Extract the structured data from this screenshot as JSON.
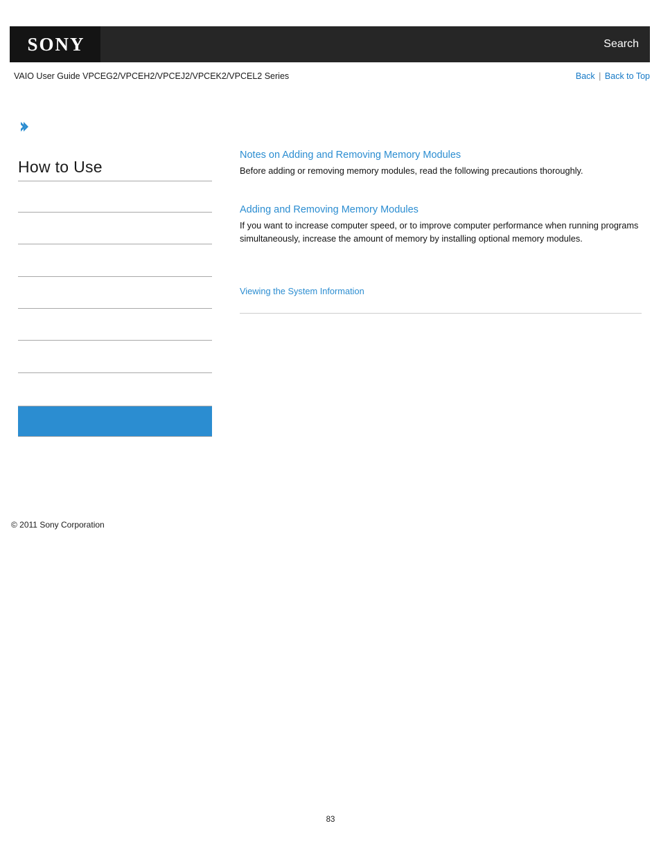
{
  "header": {
    "logo_text": "SONY",
    "search_label": "Search",
    "bar_color": "#262626",
    "logo_box_color": "#141414"
  },
  "subheader": {
    "title": "VAIO User Guide VPCEG2/VPCEH2/VPCEJ2/VPCEK2/VPCEL2 Series",
    "back_label": "Back",
    "separator": "|",
    "back_to_top_label": "Back to Top",
    "link_color": "#1579c6"
  },
  "sidebar": {
    "chevron_icon": "chevron-right-icon",
    "title": "How to Use",
    "accent_color": "#2b8dd1",
    "divider_color": "#a8a8a8",
    "items": [
      {
        "label": "",
        "active": false
      },
      {
        "label": "",
        "active": false
      },
      {
        "label": "",
        "active": false
      },
      {
        "label": "",
        "active": false
      },
      {
        "label": "",
        "active": false
      },
      {
        "label": "",
        "active": false
      },
      {
        "label": "",
        "active": false
      },
      {
        "label": "",
        "active": true
      },
      {
        "label": "",
        "active": false
      }
    ],
    "footer": "© 2011 Sony Corporation"
  },
  "content": {
    "sections": [
      {
        "heading": "Notes on Adding and Removing Memory Modules",
        "body": "Before adding or removing memory modules, read the following precautions thoroughly."
      },
      {
        "heading": "Adding and Removing Memory Modules",
        "body": "If you want to increase computer speed, or to improve computer performance when running programs simultaneously, increase the amount of memory by installing optional memory modules."
      }
    ],
    "related_link": "Viewing the System Information",
    "link_color": "#2b8dd1",
    "rule_color": "#cccccc"
  },
  "footer": {
    "page_number": "83"
  }
}
